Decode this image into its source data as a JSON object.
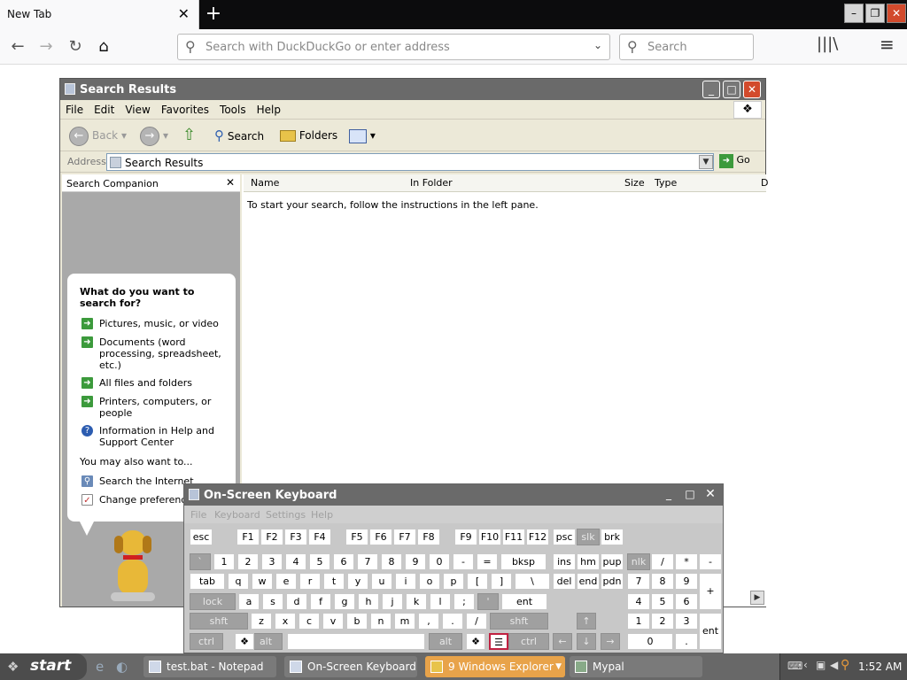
{
  "browser": {
    "tab_title": "New Tab",
    "tab_close": "✕",
    "new_tab": "+",
    "url_placeholder": "Search with DuckDuckGo or enter address",
    "search_placeholder": "Search"
  },
  "explorer": {
    "title": "Search Results",
    "menu": [
      "File",
      "Edit",
      "View",
      "Favorites",
      "Tools",
      "Help"
    ],
    "toolbar": {
      "back": "Back",
      "search": "Search",
      "folders": "Folders"
    },
    "address_label": "Address",
    "address_value": "Search Results",
    "go_label": "Go",
    "columns": [
      "Name",
      "In Folder",
      "Size",
      "Type",
      "D"
    ],
    "empty_message": "To start your search, follow the instructions in the left pane.",
    "companion": {
      "header": "Search Companion",
      "close": "✕",
      "question": "What do you want to search for?",
      "options": [
        "Pictures, music, or video",
        "Documents (word processing, spreadsheet, etc.)",
        "All files and folders",
        "Printers, computers, or people",
        "Information in Help and Support Center"
      ],
      "also_label": "You may also want to...",
      "also": [
        "Search the Internet",
        "Change preferences"
      ]
    }
  },
  "osk": {
    "title": "On-Screen Keyboard",
    "menu": [
      "File",
      "Keyboard",
      "Settings",
      "Help"
    ],
    "row_fn": [
      "esc",
      "F1",
      "F2",
      "F3",
      "F4",
      "F5",
      "F6",
      "F7",
      "F8",
      "F9",
      "F10",
      "F11",
      "F12",
      "psc",
      "slk",
      "brk"
    ],
    "row_num": [
      "`",
      "1",
      "2",
      "3",
      "4",
      "5",
      "6",
      "7",
      "8",
      "9",
      "0",
      "-",
      "=",
      "bksp",
      "ins",
      "hm",
      "pup",
      "nlk",
      "/",
      "*",
      "-"
    ],
    "row_tab": [
      "tab",
      "q",
      "w",
      "e",
      "r",
      "t",
      "y",
      "u",
      "i",
      "o",
      "p",
      "[",
      "]",
      "\\",
      "del",
      "end",
      "pdn",
      "7",
      "8",
      "9",
      "+"
    ],
    "row_caps": [
      "lock",
      "a",
      "s",
      "d",
      "f",
      "g",
      "h",
      "j",
      "k",
      "l",
      ";",
      "'",
      "ent",
      "4",
      "5",
      "6"
    ],
    "row_shift": [
      "shft",
      "z",
      "x",
      "c",
      "v",
      "b",
      "n",
      "m",
      ",",
      ".",
      "/",
      "shft",
      "1",
      "2",
      "3",
      "ent"
    ],
    "row_ctrl": [
      "ctrl",
      "alt",
      "alt",
      "ctrl",
      "0",
      "."
    ]
  },
  "taskbar": {
    "start": "start",
    "tasks": [
      "test.bat - Notepad",
      "On-Screen Keyboard",
      "9 Windows Explorer",
      "Mypal"
    ],
    "clock": "1:52 AM"
  }
}
